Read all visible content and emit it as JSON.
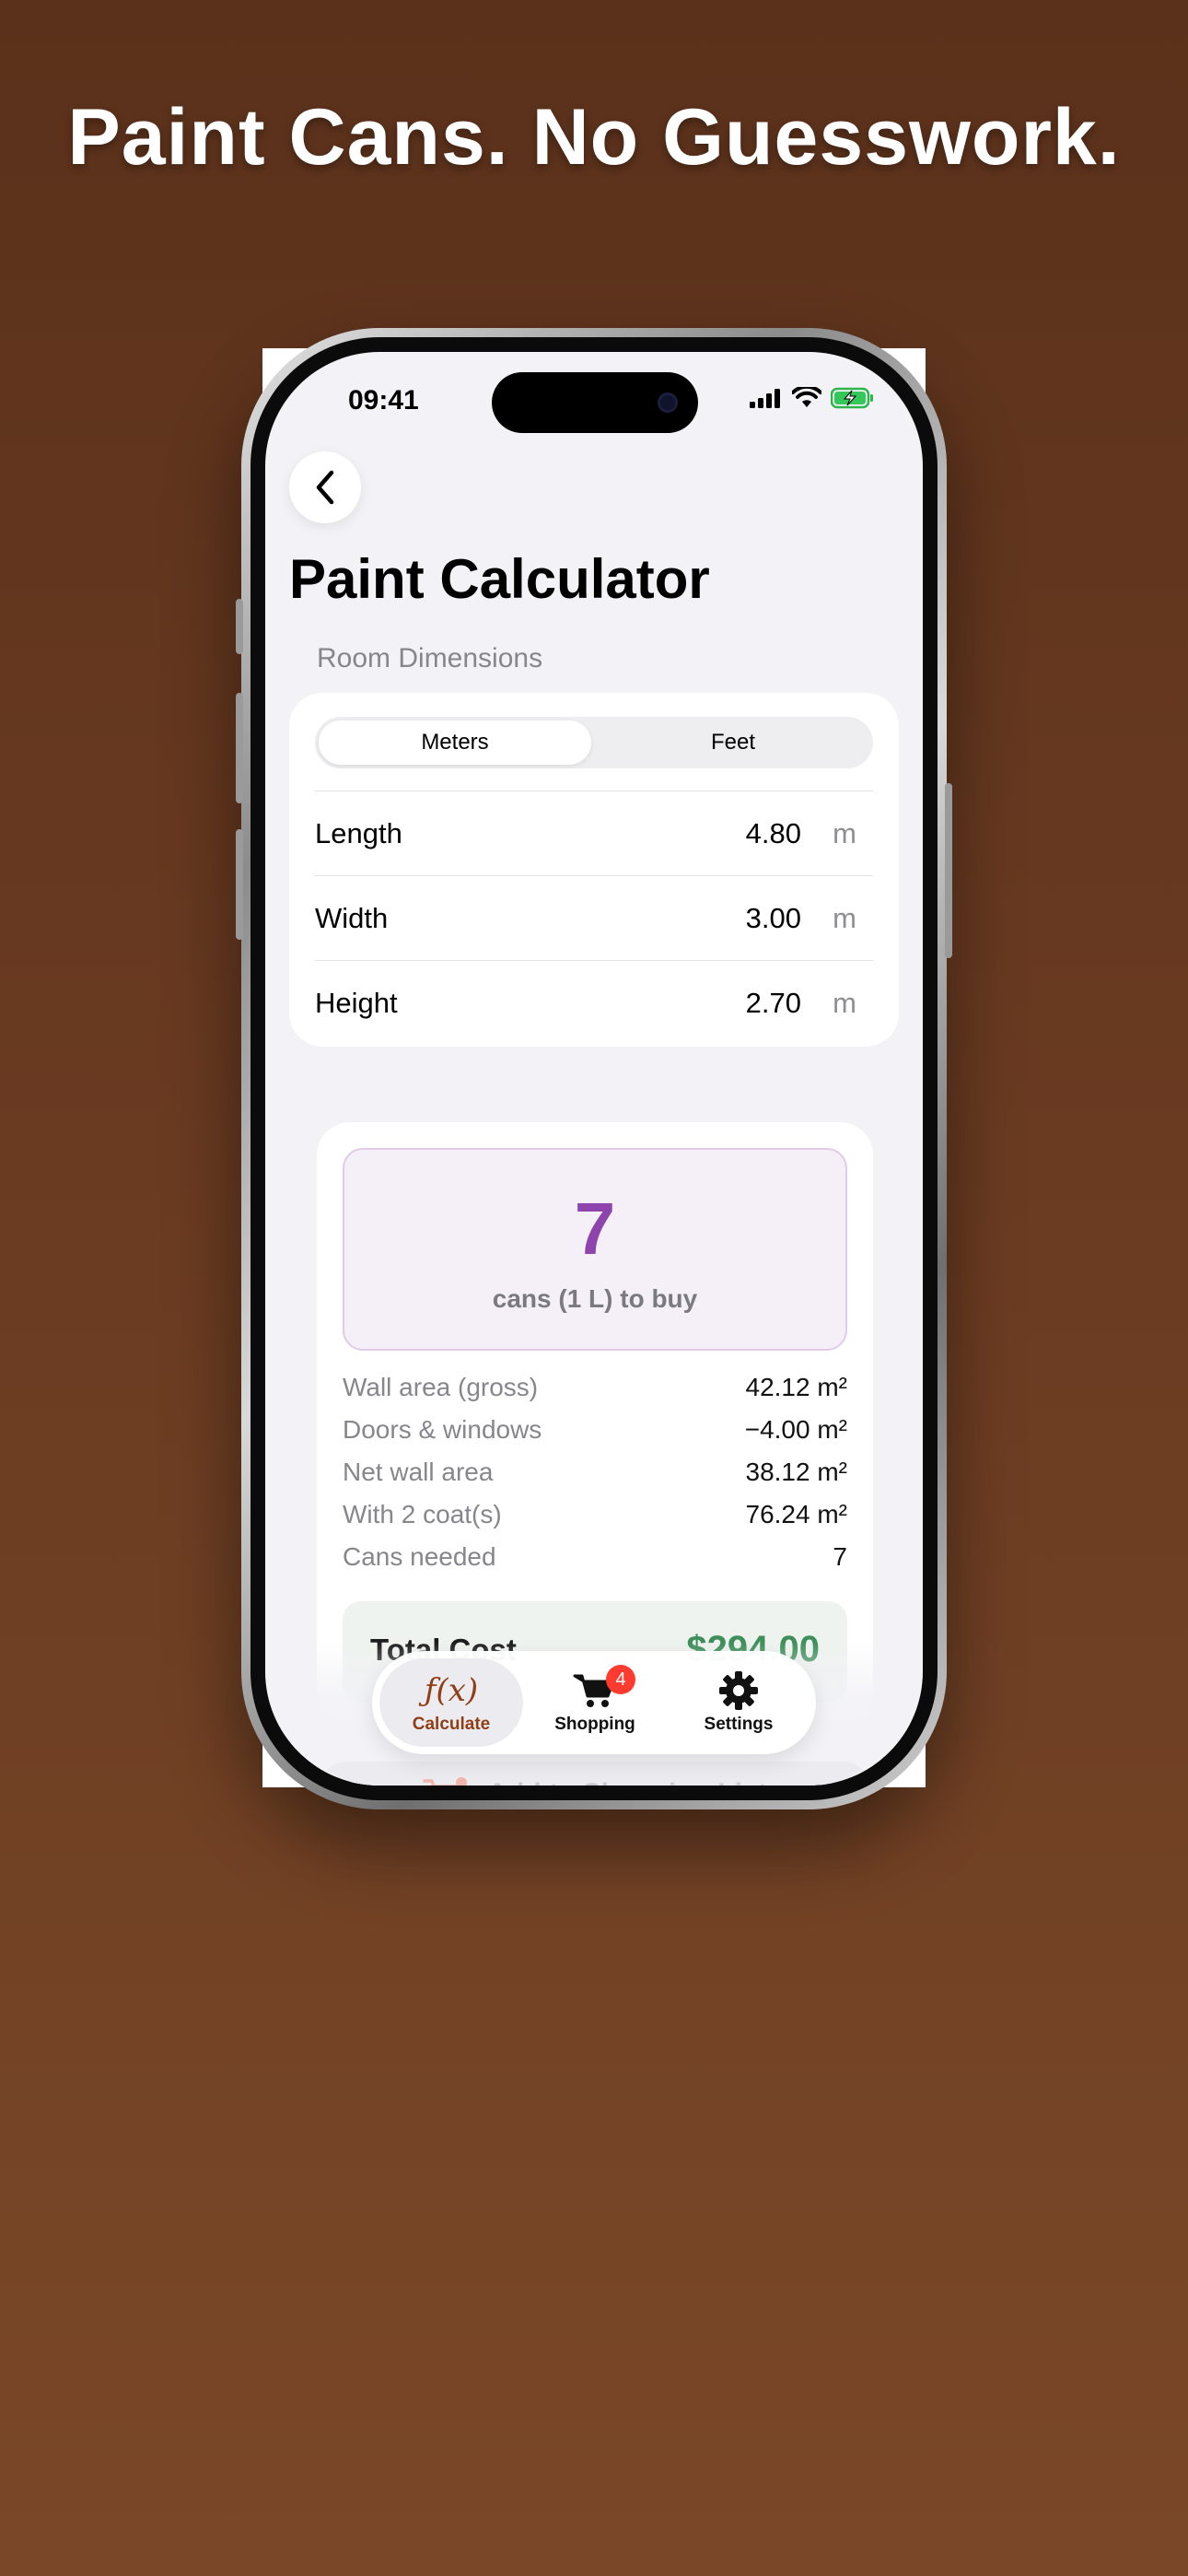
{
  "headline": "Paint Cans. No Guesswork.",
  "status_bar": {
    "time": "09:41"
  },
  "nav": {
    "title": "Paint Calculator",
    "back_icon": "chevron-left-icon"
  },
  "room": {
    "section_label": "Room Dimensions",
    "units": [
      {
        "label": "Meters",
        "selected": true
      },
      {
        "label": "Feet",
        "selected": false
      }
    ],
    "rows": [
      {
        "label": "Length",
        "value": "4.80",
        "unit": "m"
      },
      {
        "label": "Width",
        "value": "3.00",
        "unit": "m"
      },
      {
        "label": "Height",
        "value": "2.70",
        "unit": "m"
      }
    ]
  },
  "result": {
    "cans": "7",
    "caption": "cans (1 L) to buy",
    "stats": [
      {
        "label": "Wall area (gross)",
        "value": "42.12 m²"
      },
      {
        "label": "Doors & windows",
        "value": "−4.00 m²"
      },
      {
        "label": "Net wall area",
        "value": "38.12 m²"
      },
      {
        "label": "With 2 coat(s)",
        "value": "76.24 m²"
      },
      {
        "label": "Cans needed",
        "value": "7"
      }
    ],
    "total_label": "Total Cost",
    "total_value": "$294.00"
  },
  "add_button": {
    "label": "Add to Shopping List"
  },
  "tabbar": {
    "tabs": [
      {
        "label": "Calculate",
        "icon": "function-icon",
        "active": true
      },
      {
        "label": "Shopping",
        "icon": "cart-icon",
        "active": false,
        "badge": "4"
      },
      {
        "label": "Settings",
        "icon": "gear-icon",
        "active": false
      }
    ]
  },
  "colors": {
    "background": "#5b311b",
    "accent_purple": "#8e44ad",
    "accent_brown": "#8f3e16",
    "total_green": "#3f8f5a",
    "badge_red": "#ff3b30"
  }
}
